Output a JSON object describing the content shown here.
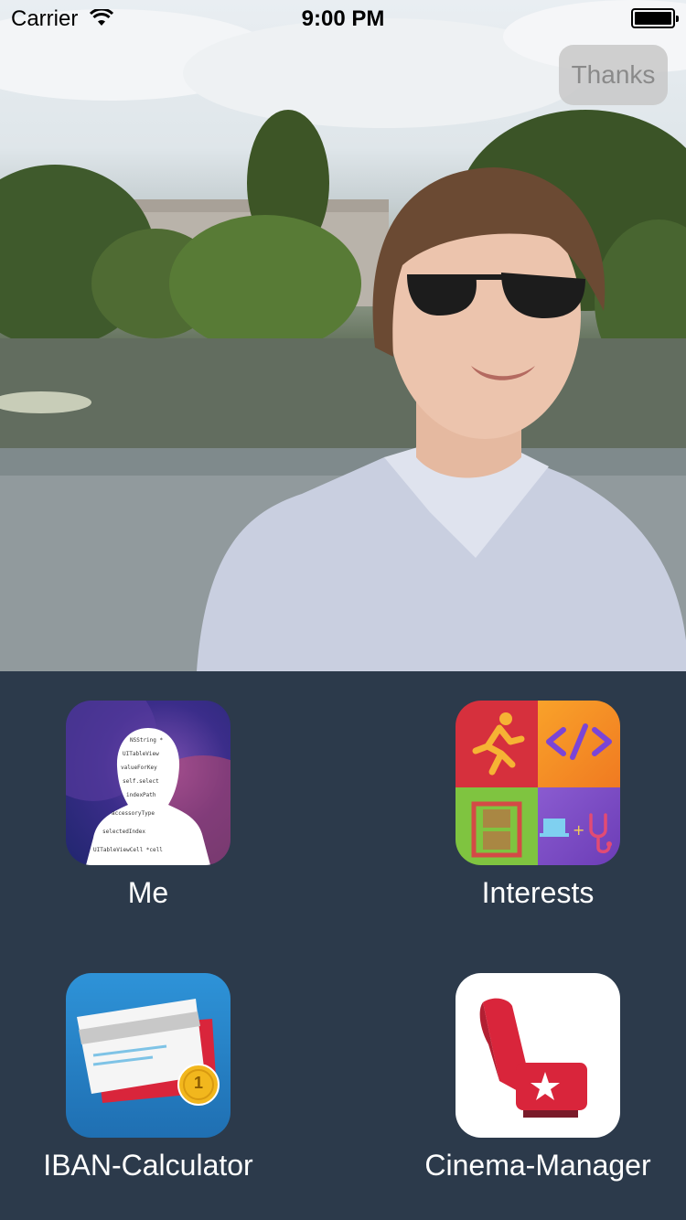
{
  "status_bar": {
    "carrier": "Carrier",
    "time": "9:00 PM",
    "battery_level": 1.0
  },
  "hero": {
    "thanks_label": "Thanks"
  },
  "apps": [
    {
      "label": "Me",
      "icon": "person-silhouette-code-icon"
    },
    {
      "label": "Interests",
      "icon": "interests-grid-icon"
    },
    {
      "label": "IBAN-Calculator",
      "icon": "bank-card-icon",
      "badge": "1"
    },
    {
      "label": "Cinema-Manager",
      "icon": "cinema-seat-icon"
    }
  ],
  "colors": {
    "background": "#2c3a4b",
    "label": "#ffffff",
    "thanks_text": "#8a8a8a"
  }
}
